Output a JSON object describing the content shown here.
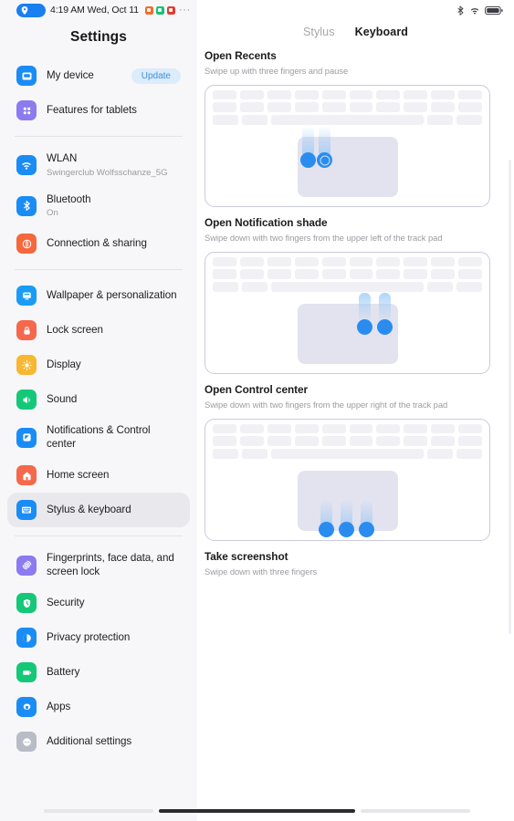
{
  "status_bar": {
    "location_icon": "location-pin-icon",
    "time": "4:19 AM Wed, Oct 11",
    "app_icons": [
      "app-badge-orange",
      "app-badge-green",
      "app-badge-red"
    ],
    "overflow": "···",
    "right_icons": [
      "bluetooth-icon",
      "wifi-icon",
      "battery-icon"
    ],
    "battery_level": "86"
  },
  "sidebar": {
    "title": "Settings",
    "groups": [
      {
        "items": [
          {
            "label": "My device",
            "sub": null,
            "icon": "device-icon",
            "color": "#1a8cf5",
            "badge": "Update",
            "selected": false
          },
          {
            "label": "Features for tablets",
            "sub": null,
            "icon": "tablet-features-icon",
            "color": "#8a7bf0",
            "badge": null,
            "selected": false
          }
        ]
      },
      {
        "items": [
          {
            "label": "WLAN",
            "sub": "Swingerclub Wolfsschanze_5G",
            "icon": "wifi-icon",
            "color": "#1a8cf5",
            "badge": null,
            "selected": false
          },
          {
            "label": "Bluetooth",
            "sub": "On",
            "icon": "bluetooth-icon",
            "color": "#1a8cf5",
            "badge": null,
            "selected": false
          },
          {
            "label": "Connection & sharing",
            "sub": null,
            "icon": "connection-sharing-icon",
            "color": "#f5683c",
            "badge": null,
            "selected": false
          }
        ]
      },
      {
        "items": [
          {
            "label": "Wallpaper & personalization",
            "sub": null,
            "icon": "wallpaper-icon",
            "color": "#1a9cf5",
            "badge": null,
            "selected": false
          },
          {
            "label": "Lock screen",
            "sub": null,
            "icon": "lock-screen-icon",
            "color": "#f5684c",
            "badge": null,
            "selected": false
          },
          {
            "label": "Display",
            "sub": null,
            "icon": "display-brightness-icon",
            "color": "#f7b733",
            "badge": null,
            "selected": false
          },
          {
            "label": "Sound",
            "sub": null,
            "icon": "sound-speaker-icon",
            "color": "#14c878",
            "badge": null,
            "selected": false
          },
          {
            "label": "Notifications & Control center",
            "sub": null,
            "icon": "notifications-icon",
            "color": "#1a8cf5",
            "badge": null,
            "selected": false
          },
          {
            "label": "Home screen",
            "sub": null,
            "icon": "home-screen-icon",
            "color": "#f5684c",
            "badge": null,
            "selected": false
          },
          {
            "label": "Stylus & keyboard",
            "sub": null,
            "icon": "keyboard-icon",
            "color": "#1a8cf5",
            "badge": null,
            "selected": true
          }
        ]
      },
      {
        "items": [
          {
            "label": "Fingerprints, face data, and screen lock",
            "sub": null,
            "icon": "fingerprint-icon",
            "color": "#8a7bf0",
            "badge": null,
            "selected": false
          },
          {
            "label": "Security",
            "sub": null,
            "icon": "security-shield-icon",
            "color": "#14c878",
            "badge": null,
            "selected": false
          },
          {
            "label": "Privacy protection",
            "sub": null,
            "icon": "privacy-icon",
            "color": "#1a8cf5",
            "badge": null,
            "selected": false
          },
          {
            "label": "Battery",
            "sub": null,
            "icon": "battery-icon",
            "color": "#14c878",
            "badge": null,
            "selected": false
          },
          {
            "label": "Apps",
            "sub": null,
            "icon": "apps-gear-icon",
            "color": "#1a8cf5",
            "badge": null,
            "selected": false
          },
          {
            "label": "Additional settings",
            "sub": null,
            "icon": "additional-settings-icon",
            "color": "#b8bcc6",
            "badge": null,
            "selected": false
          }
        ]
      }
    ]
  },
  "main": {
    "tabs": [
      {
        "label": "Stylus",
        "active": false
      },
      {
        "label": "Keyboard",
        "active": true
      }
    ],
    "gestures": [
      {
        "title": "Open Recents",
        "desc": "Swipe up with three fingers and pause",
        "illustration": "trackpad-two-fingers-swipe-up"
      },
      {
        "title": "Open Notification shade",
        "desc": "Swipe down with two fingers from the upper left of the track pad",
        "illustration": "trackpad-two-fingers-swipe-down-right"
      },
      {
        "title": "Open Control center",
        "desc": "Swipe down with two fingers from the upper right of the track pad",
        "illustration": "trackpad-three-fingers-swipe-down"
      },
      {
        "title": "Take screenshot",
        "desc": "Swipe down with three fingers",
        "illustration": null
      }
    ]
  },
  "colors": {
    "accent": "#2b8cf0",
    "selected_bg": "#e9e9ed",
    "badge_bg": "#dbecfb",
    "badge_text": "#3d8fde"
  }
}
